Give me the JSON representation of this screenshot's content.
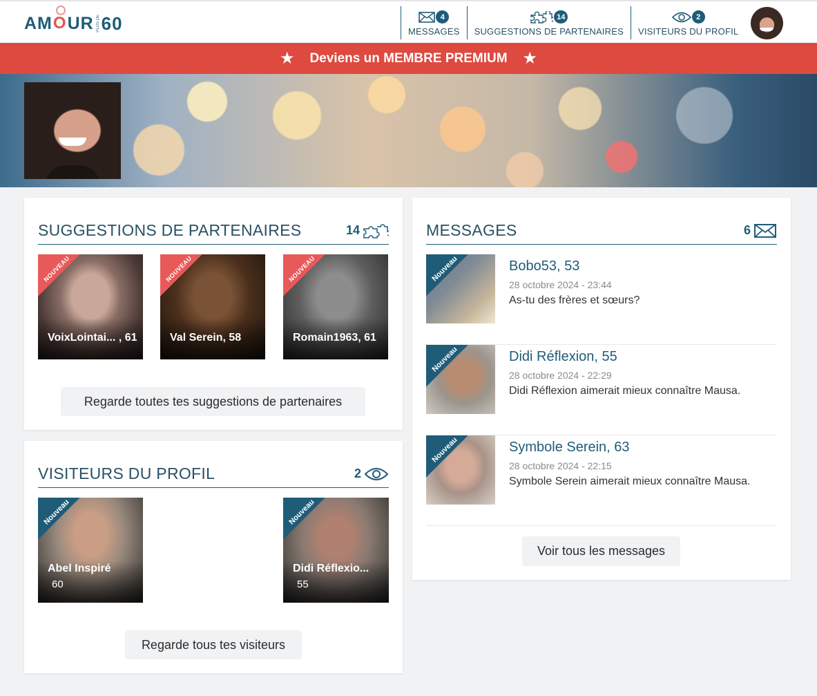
{
  "header": {
    "logo": {
      "text_a": "AM",
      "heart": "O",
      "text_b": "UR",
      "tiny": "PLUS DE",
      "num": "60"
    },
    "nav": [
      {
        "label": "MESSAGES",
        "count": "4",
        "icon": "envelope-icon"
      },
      {
        "label": "SUGGESTIONS DE PARTENAIRES",
        "count": "14",
        "icon": "puzzle-icon"
      },
      {
        "label": "VISITEURS DU PROFIL",
        "count": "2",
        "icon": "eye-icon"
      }
    ]
  },
  "premium": {
    "label": "Deviens un MEMBRE PREMIUM"
  },
  "suggestions": {
    "title": "SUGGESTIONS DE PARTENAIRES",
    "count": "14",
    "ribbon": "Nouveau",
    "items": [
      {
        "name": "VoixLointai... , 61"
      },
      {
        "name": "Val Serein, 58"
      },
      {
        "name": "Romain1963, 61"
      }
    ],
    "button": "Regarde toutes tes suggestions de partenaires"
  },
  "visitors": {
    "title": "VISITEURS DU PROFIL",
    "count": "2",
    "ribbon": "Nouveau",
    "items": [
      {
        "name": "Abel Inspiré",
        "age": "60"
      },
      {
        "name": "Didi Réflexio...",
        "age": "55"
      }
    ],
    "button": "Regarde tous tes visiteurs"
  },
  "messages": {
    "title": "MESSAGES",
    "count": "6",
    "ribbon": "Nouveau",
    "items": [
      {
        "name": "Bobo53, 53",
        "date": "28 octobre 2024 - 23:44",
        "text": "As-tu des frères et sœurs?"
      },
      {
        "name": "Didi Réflexion, 55",
        "date": "28 octobre 2024 - 22:29",
        "text": "Didi Réflexion aimerait mieux connaître Mausa."
      },
      {
        "name": "Symbole Serein, 63",
        "date": "28 octobre 2024 - 22:15",
        "text": "Symbole Serein aimerait mieux connaître Mausa."
      }
    ],
    "button": "Voir tous les messages"
  },
  "colors": {
    "brand": "#1f5c78",
    "premium": "#de4a40",
    "ribbon_new": "#e85a5a"
  }
}
